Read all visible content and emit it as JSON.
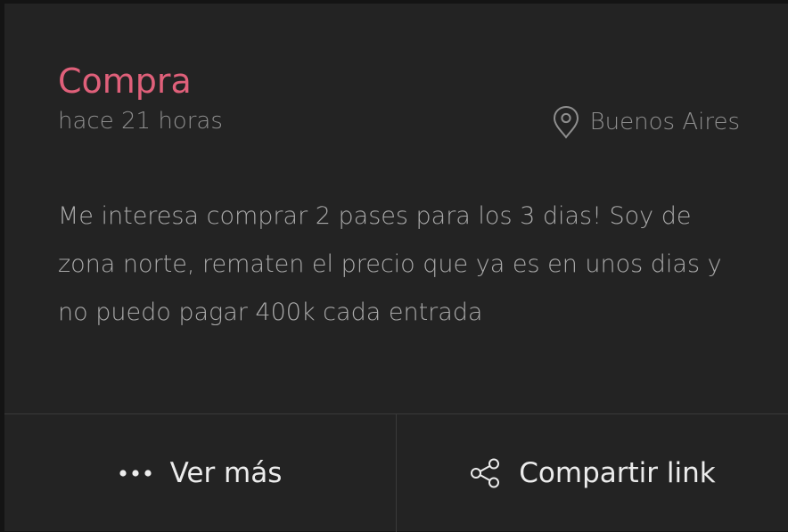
{
  "post": {
    "title": "Compra",
    "time_ago": "hace 21 horas",
    "location": "Buenos Aires",
    "location_icon": "location-pin-icon",
    "message": "Me interesa comprar 2 pases para los 3 dias! Soy de zona norte, rematen el precio que ya es en unos dias y no puedo pagar 400k cada entrada",
    "title_color": "#e0607a"
  },
  "actions": {
    "more_label": "Ver más",
    "more_icon": "more-dots-icon",
    "share_label": "Compartir link",
    "share_icon": "share-icon"
  }
}
